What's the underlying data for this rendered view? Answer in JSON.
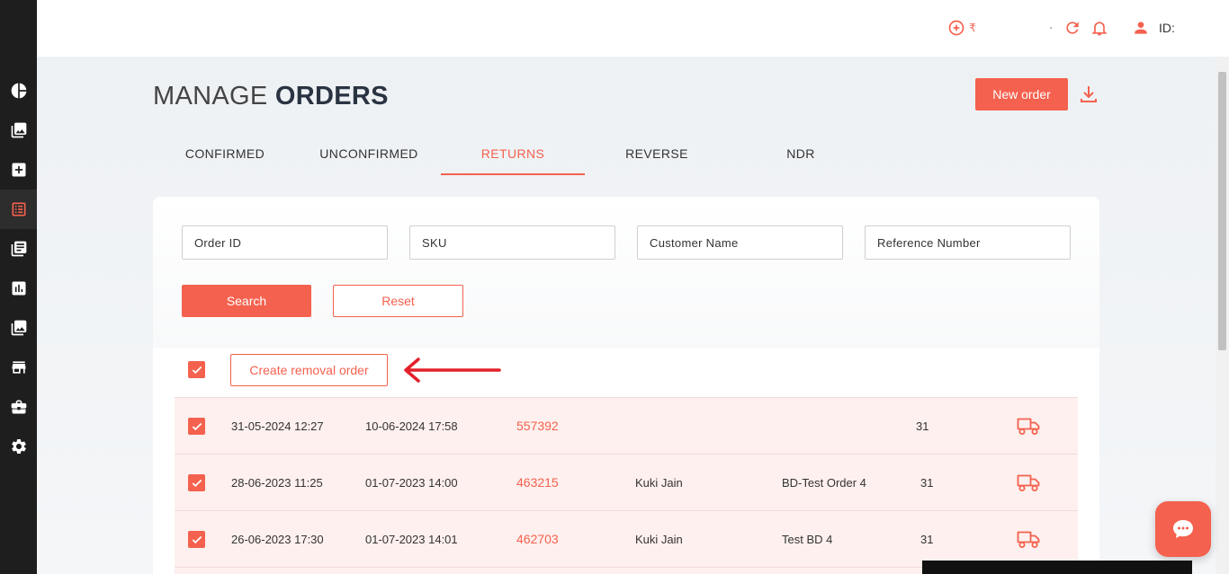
{
  "colors": {
    "accent": "#f4614e",
    "sidebar": "#1e1e1e",
    "row_bg": "#fdf0ee"
  },
  "sidebar": {
    "items": [
      {
        "icon": "pie-chart-icon"
      },
      {
        "icon": "image-icon"
      },
      {
        "icon": "add-box-icon"
      },
      {
        "icon": "list-icon",
        "active": true
      },
      {
        "icon": "library-books-icon"
      },
      {
        "icon": "bar-chart-icon"
      },
      {
        "icon": "photo-library-icon"
      },
      {
        "icon": "store-icon"
      },
      {
        "icon": "briefcase-icon"
      },
      {
        "icon": "gear-icon"
      }
    ]
  },
  "header": {
    "currency": "₹",
    "id_label": "ID:"
  },
  "page": {
    "title_light": "MANAGE",
    "title_bold": "ORDERS",
    "new_order": "New order"
  },
  "tabs": [
    {
      "label": "CONFIRMED"
    },
    {
      "label": "UNCONFIRMED"
    },
    {
      "label": "RETURNS",
      "active": true
    },
    {
      "label": "REVERSE"
    },
    {
      "label": "NDR"
    }
  ],
  "filters": {
    "order_id": "Order ID",
    "sku": "SKU",
    "customer_name": "Customer Name",
    "reference_number": "Reference Number",
    "search": "Search",
    "reset": "Reset"
  },
  "actions": {
    "create_removal": "Create removal order"
  },
  "rows": [
    {
      "created": "31-05-2024 12:27",
      "updated": "10-06-2024 17:58",
      "order_id": "557392",
      "customer": "",
      "reference": "",
      "qty": "31"
    },
    {
      "created": "28-06-2023 11:25",
      "updated": "01-07-2023 14:00",
      "order_id": "463215",
      "customer": "Kuki Jain",
      "reference": "BD-Test Order 4",
      "qty": "31"
    },
    {
      "created": "26-06-2023 17:30",
      "updated": "01-07-2023 14:01",
      "order_id": "462703",
      "customer": "Kuki Jain",
      "reference": "Test BD 4",
      "qty": "31"
    }
  ]
}
